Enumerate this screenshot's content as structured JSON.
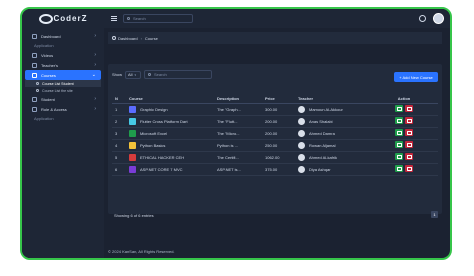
{
  "brand": {
    "logo_text": "CoderZ"
  },
  "sidebar": {
    "dashboard": "Dashboard",
    "section_application": "Application",
    "videos": "Videos",
    "teachers": "Teacher's",
    "courses": "Courses",
    "sub_course_list_student": "Course List Student",
    "sub_course_list_site": "Course List the site",
    "student": "Student",
    "roles": "Role & Access",
    "section_application2": "Application"
  },
  "topbar": {
    "search_placeholder": "Search"
  },
  "breadcrumb": {
    "home": "Dashboard",
    "current": "Course"
  },
  "controls": {
    "show_label": "Show",
    "entries_value": "All",
    "search_placeholder": "Search",
    "add_button": "+ Add New Course"
  },
  "table": {
    "headers": [
      "N",
      "Course",
      "Description",
      "Price",
      "Teacher",
      "Action"
    ],
    "rows": [
      {
        "n": "1",
        "course": "Graphic Design",
        "desc": "The \"Graph...",
        "price": "300.00",
        "teacher": "Mamoun Al-Akkour",
        "icon_color": "#5b6cff"
      },
      {
        "n": "2",
        "course": "Flutter Cross Platform Dart",
        "desc": "The \"Flutt...",
        "price": "200.00",
        "teacher": "Anas Shalabi",
        "icon_color": "#46c9e5"
      },
      {
        "n": "3",
        "course": "Microsoft Excel",
        "desc": "The \"Micro...",
        "price": "200.00",
        "teacher": "Ahmed Damra",
        "icon_color": "#1f9d4c"
      },
      {
        "n": "4",
        "course": "Python Basics",
        "desc": "Python is ...",
        "price": "250.00",
        "teacher": "Rowan Aljamal",
        "icon_color": "#f2c23a"
      },
      {
        "n": "5",
        "course": "ETHICAL HACKER CEH",
        "desc": "The Certifi...",
        "price": "1062.00",
        "teacher": "Ahmed Al-kafrik",
        "icon_color": "#d63c3c"
      },
      {
        "n": "6",
        "course": "ASP.NET CORE 7 MVC",
        "desc": "ASP.NET is...",
        "price": "375.00",
        "teacher": "Diya Ashqar",
        "icon_color": "#7a3cd6"
      }
    ],
    "showing": "Showing 6 of 6 entries",
    "page": "1"
  },
  "footer": {
    "text": "© 2024 KanSan, All Rights Reserved."
  }
}
